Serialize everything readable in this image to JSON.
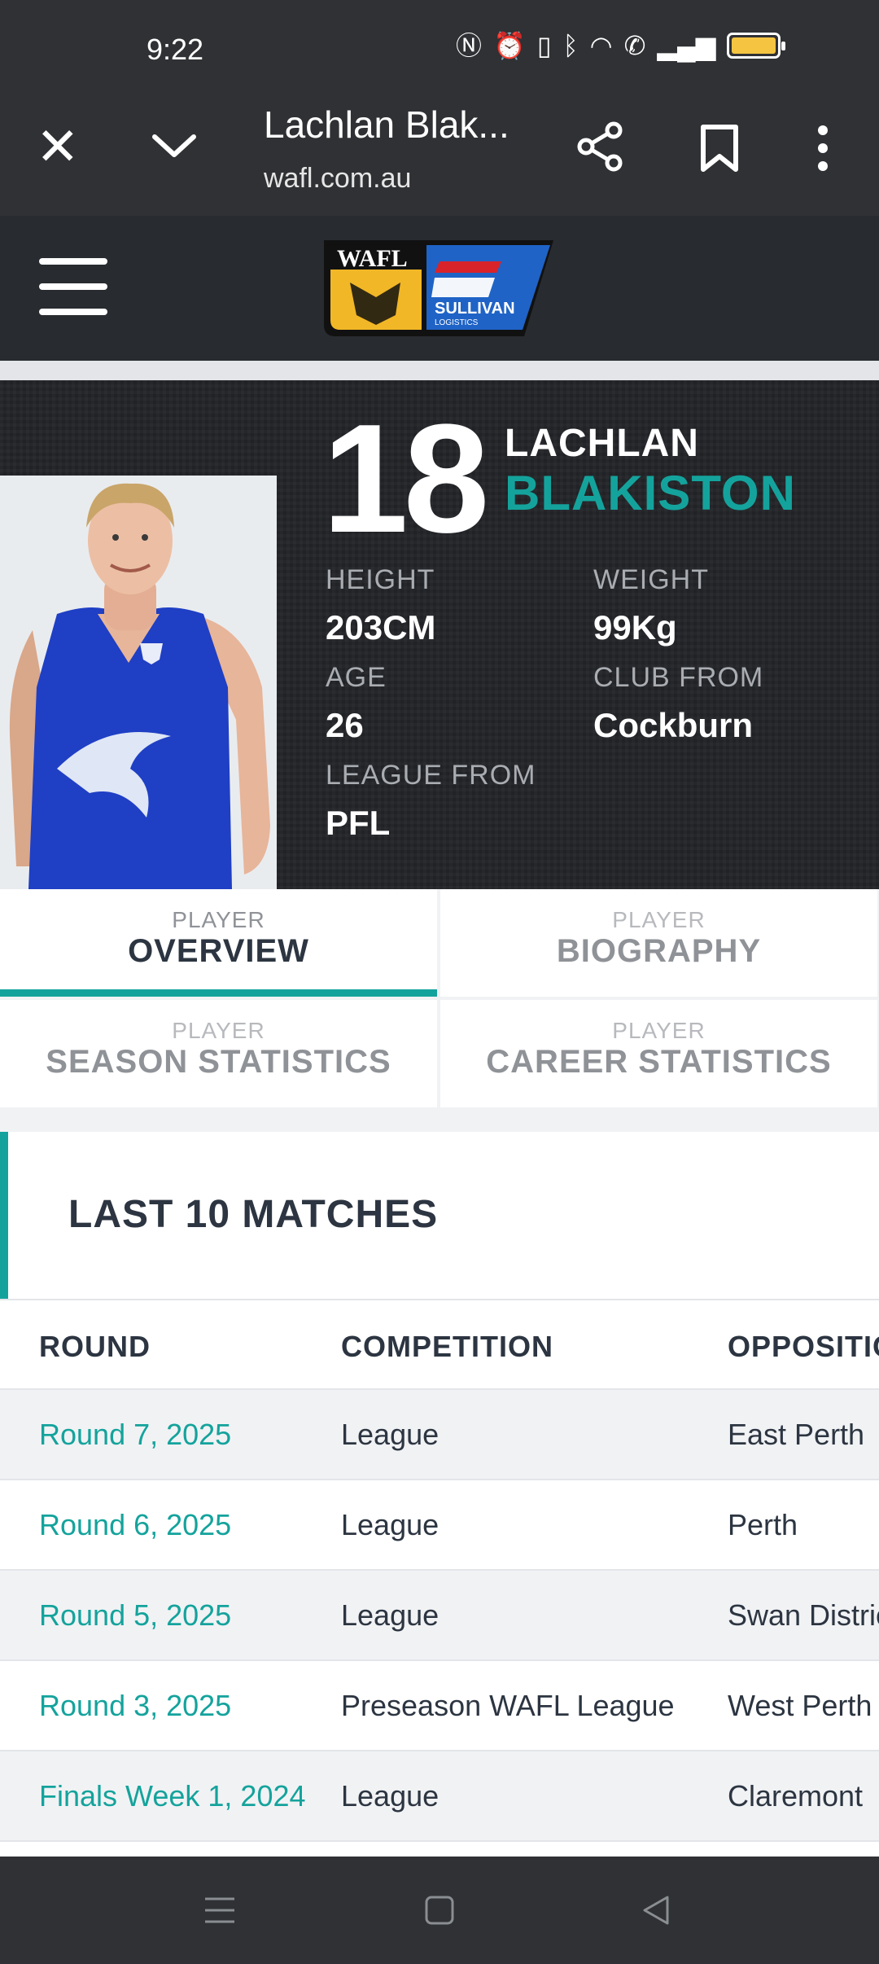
{
  "status_bar": {
    "time": "9:22"
  },
  "browser": {
    "title": "Lachlan Blak...",
    "url": "wafl.com.au"
  },
  "site": {
    "logo_text": "WAFL",
    "sponsor_text": "SULLIVAN",
    "sponsor_sub": "LOGISTICS"
  },
  "player": {
    "number": "18",
    "first_name": "LACHLAN",
    "last_name": "BLAKISTON",
    "stats": {
      "height_label": "HEIGHT",
      "height": "203CM",
      "weight_label": "WEIGHT",
      "weight": "99Kg",
      "age_label": "AGE",
      "age": "26",
      "club_label": "CLUB FROM",
      "club": "Cockburn",
      "league_label": "LEAGUE FROM",
      "league": "PFL"
    }
  },
  "tabs": [
    {
      "sub": "PLAYER",
      "label": "OVERVIEW"
    },
    {
      "sub": "PLAYER",
      "label": "BIOGRAPHY"
    },
    {
      "sub": "PLAYER",
      "label": "SEASON STATISTICS"
    },
    {
      "sub": "PLAYER",
      "label": "CAREER STATISTICS"
    }
  ],
  "matches": {
    "heading": "LAST 10 MATCHES",
    "columns": [
      "ROUND",
      "COMPETITION",
      "OPPOSITION"
    ],
    "rows": [
      {
        "round": "Round 7, 2025",
        "competition": "League",
        "opposition": "East Perth"
      },
      {
        "round": "Round 6, 2025",
        "competition": "League",
        "opposition": "Perth"
      },
      {
        "round": "Round 5, 2025",
        "competition": "League",
        "opposition": "Swan Districts"
      },
      {
        "round": "Round 3, 2025",
        "competition": "Preseason WAFL League",
        "opposition": "West Perth"
      },
      {
        "round": "Finals Week 1, 2024",
        "competition": "League",
        "opposition": "Claremont"
      }
    ]
  },
  "colors": {
    "accent": "#14a39c",
    "dark": "#202226",
    "text": "#2c3541"
  }
}
